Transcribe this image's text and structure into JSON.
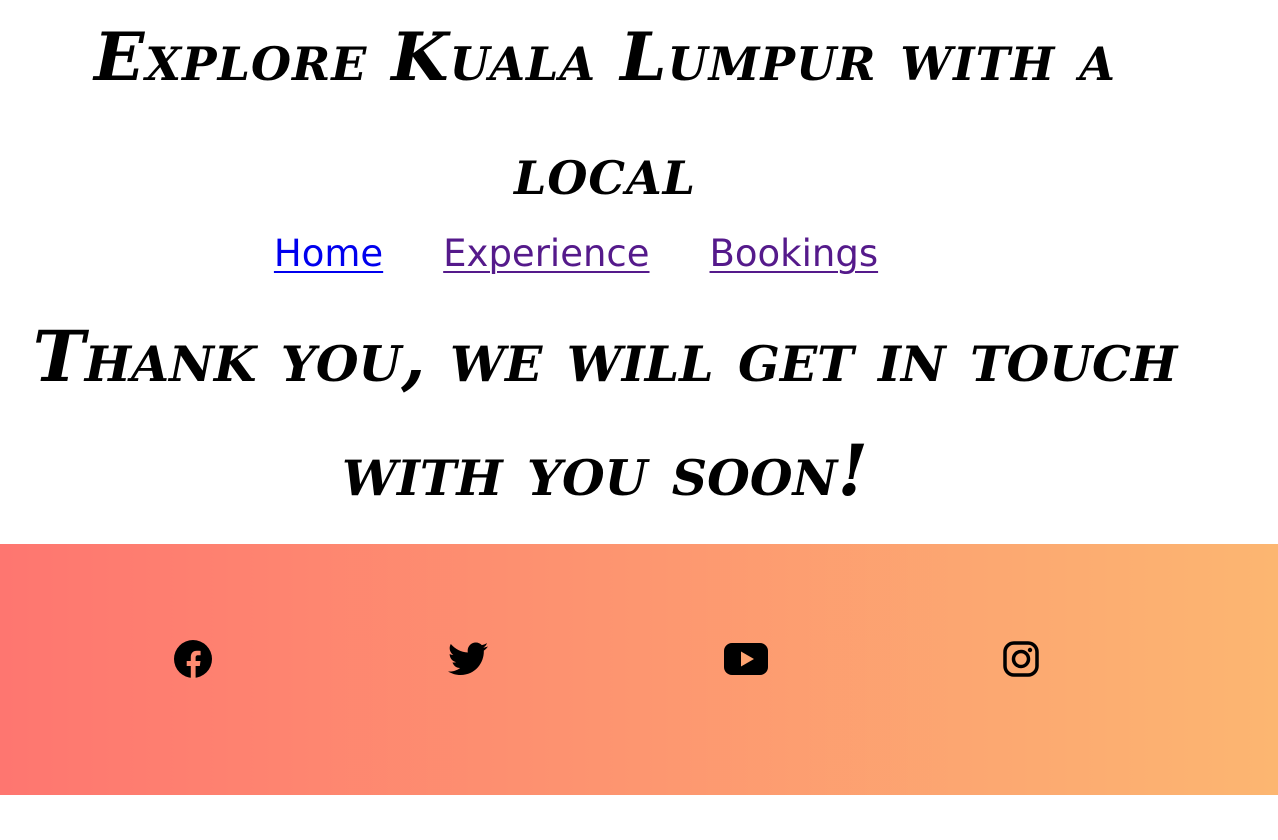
{
  "header": {
    "title": "Explore Kuala Lumpur with a local"
  },
  "nav": {
    "items": [
      {
        "label": "Home"
      },
      {
        "label": "Experience"
      },
      {
        "label": "Bookings"
      }
    ]
  },
  "main": {
    "message": "Thank you, we will get in touch with you soon!"
  },
  "footer": {
    "gradient_start": "#FE7670",
    "gradient_end": "#FCB671",
    "social_icons": [
      "facebook-icon",
      "twitter-icon",
      "youtube-icon",
      "instagram-icon"
    ]
  }
}
